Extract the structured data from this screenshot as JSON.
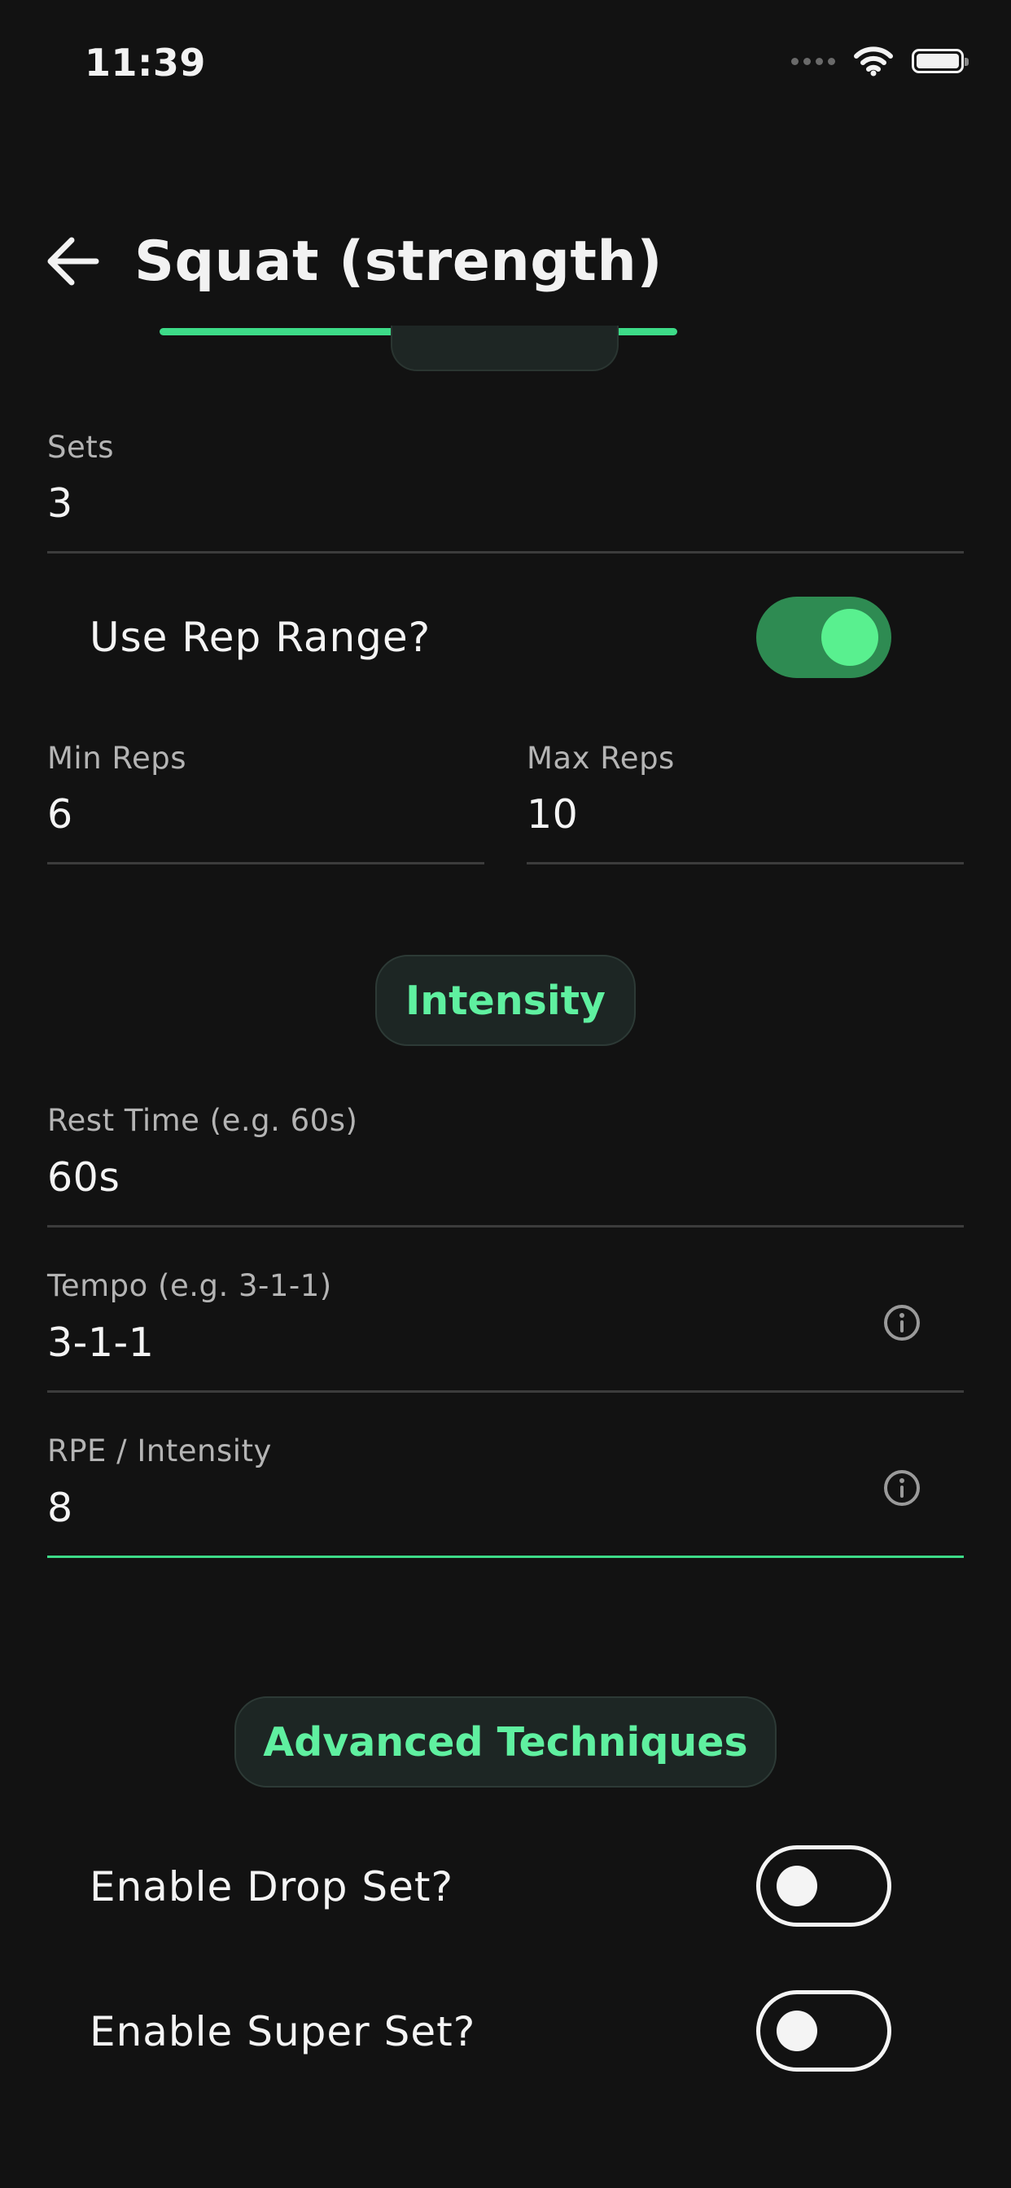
{
  "status_bar": {
    "time": "11:39"
  },
  "header": {
    "title": "Squat (strength)"
  },
  "fields": {
    "sets": {
      "label": "Sets",
      "value": "3"
    },
    "use_rep_range": {
      "label": "Use Rep Range?",
      "on": true
    },
    "min_reps": {
      "label": "Min Reps",
      "value": "6"
    },
    "max_reps": {
      "label": "Max Reps",
      "value": "10"
    },
    "rest_time": {
      "label": "Rest Time (e.g. 60s)",
      "value": "60s"
    },
    "tempo": {
      "label": "Tempo (e.g. 3-1-1)",
      "value": "3-1-1"
    },
    "rpe": {
      "label": "RPE / Intensity",
      "value": "8"
    }
  },
  "sections": {
    "intensity": "Intensity",
    "advanced": "Advanced Techniques"
  },
  "advanced": {
    "drop_set": {
      "label": "Enable Drop Set?",
      "on": false
    },
    "super_set": {
      "label": "Enable Super Set?",
      "on": false
    }
  },
  "colors": {
    "accent": "#3ddb88",
    "background": "#121212"
  }
}
